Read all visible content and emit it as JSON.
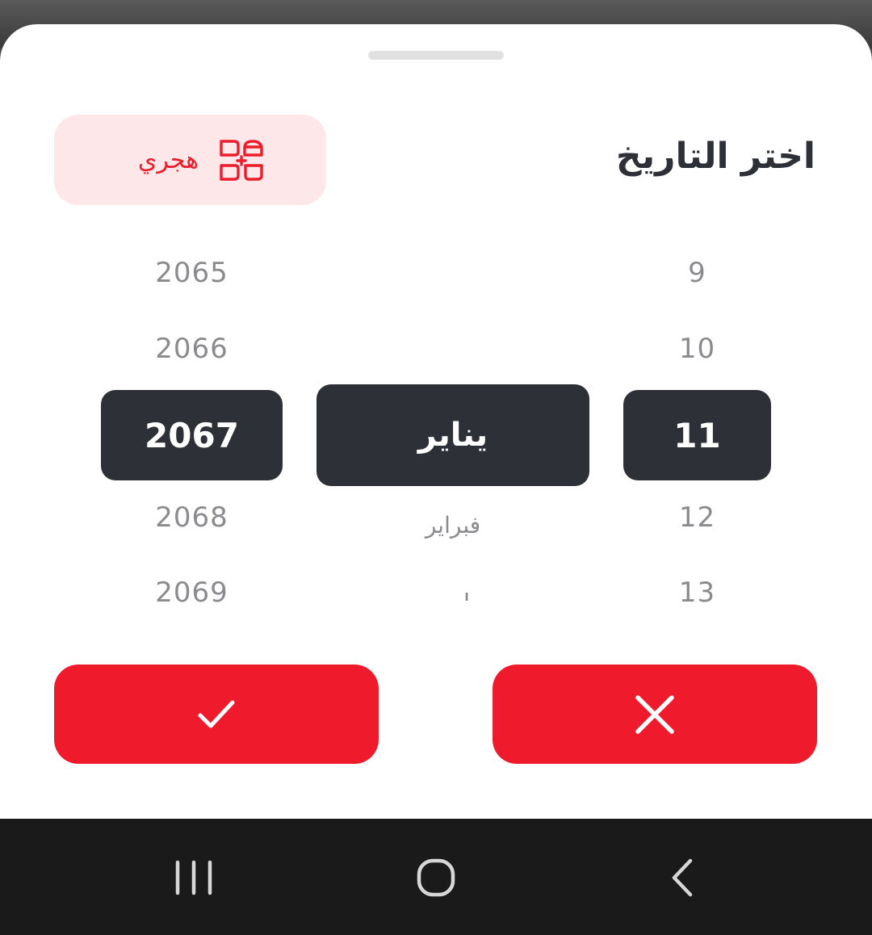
{
  "sheet": {
    "title": "اختر التاريخ",
    "calendar_toggle": {
      "label": "هجري",
      "icon": "hijri-calendar-icon"
    }
  },
  "picker": {
    "years": {
      "above": [
        "2065",
        "2066"
      ],
      "selected": "2067",
      "below": [
        "2068",
        "2069"
      ]
    },
    "months": {
      "selected": "يناير",
      "below": [
        "فبراير",
        "مارس"
      ]
    },
    "days": {
      "above": [
        "9",
        "10"
      ],
      "selected": "11",
      "below": [
        "12",
        "13"
      ]
    }
  },
  "actions": {
    "confirm_icon": "check-icon",
    "cancel_icon": "close-icon"
  },
  "navbar": {
    "recents_icon": "recent-apps-icon",
    "home_icon": "home-icon",
    "back_icon": "back-icon"
  },
  "colors": {
    "accent": "#ef1b2c",
    "accent_soft": "#fde7e8",
    "selected_bg": "#2e3038",
    "muted_text": "#8b8b8f"
  }
}
